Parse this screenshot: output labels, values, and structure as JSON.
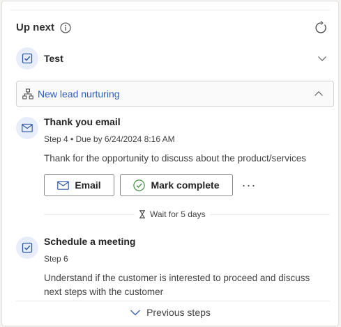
{
  "header": {
    "title": "Up next",
    "info_icon": "info-icon",
    "refresh_icon": "refresh-icon"
  },
  "test_row": {
    "label": "Test",
    "icon": "task-checkbox-icon"
  },
  "sequence": {
    "name": "New lead nurturing",
    "icon": "org-chart-icon",
    "expanded": true
  },
  "steps": [
    {
      "title": "Thank you email",
      "meta": "Step 4 • Due by 6/24/2024 8:16 AM",
      "description": "Thank for the opportunity to discuss about  the product/services",
      "icon": "mail-icon",
      "actions": {
        "email_label": "Email",
        "complete_label": "Mark complete",
        "more_label": "···"
      }
    },
    {
      "title": "Schedule a meeting",
      "meta": "Step 6",
      "description": "Understand if the customer is interested to proceed and discuss next steps with the customer",
      "icon": "task-checkbox-icon"
    }
  ],
  "wait": {
    "label": "Wait for 5 days",
    "icon": "hourglass-icon"
  },
  "footer": {
    "previous_label": "Previous steps"
  },
  "colors": {
    "accent": "#2b5dc5",
    "icon_blue": "#2f5aa8",
    "circle_bg": "#e8eef9",
    "complete_green": "#3a8f3a"
  }
}
